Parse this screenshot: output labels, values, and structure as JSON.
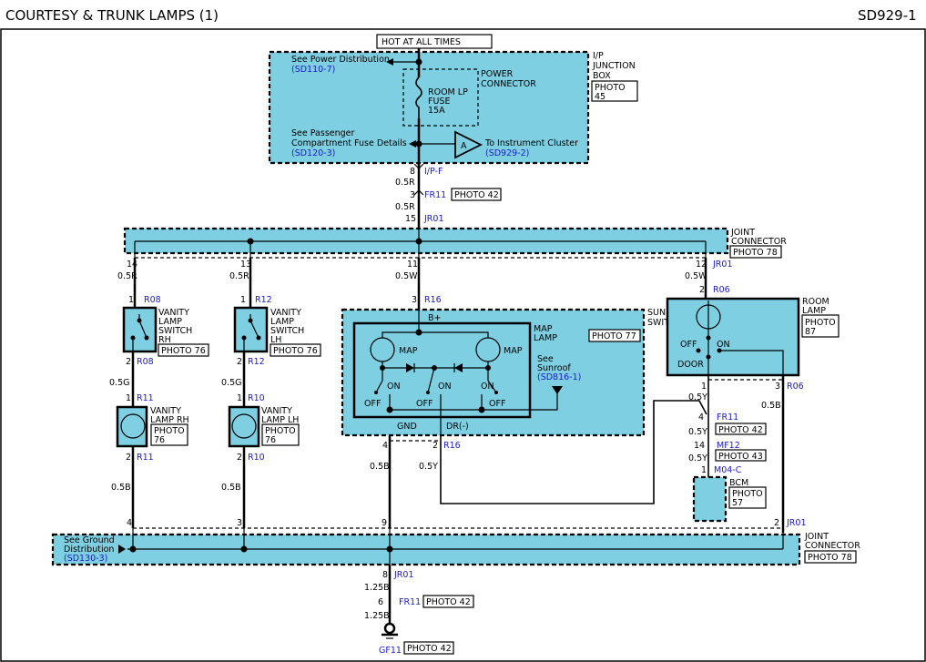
{
  "header": {
    "title": "COURTESY & TRUNK LAMPS (1)",
    "code": "SD929-1"
  },
  "colors": {
    "component_fill": "#7ecfe2",
    "reference_text": "#1a1acc"
  },
  "ipjb": {
    "hot": "HOT AT ALL TIMES",
    "see_power": "See Power Distribution",
    "sd110": "(SD110-7)",
    "power_connector": [
      "POWER",
      "CONNECTOR"
    ],
    "fuse": [
      "ROOM LP",
      "FUSE",
      "15A"
    ],
    "see_pass": [
      "See Passenger",
      "Compartment Fuse Details"
    ],
    "sd120": "(SD120-3)",
    "a": "A",
    "to_ic": "To Instrument Cluster",
    "sd929": "(SD929-2)",
    "name": [
      "I/P",
      "JUNCTION",
      "BOX"
    ],
    "photo": [
      "PHOTO",
      "45"
    ]
  },
  "feed": {
    "p8": "8",
    "ipf": "I/P-F",
    "w1": "0.5R",
    "p3": "3",
    "fr11": "FR11",
    "photo42": "PHOTO 42",
    "w2": "0.5R",
    "p15": "15",
    "jr01": "JR01"
  },
  "jc_top": {
    "name": [
      "JOINT",
      "CONNECTOR"
    ],
    "photo": "PHOTO 78",
    "pins": [
      "14",
      "13",
      "11",
      "12"
    ],
    "jr01": "JR01",
    "wires": [
      "0.5R",
      "0.5R",
      "0.5W",
      "0.5W"
    ]
  },
  "vanity_rh": {
    "p1": "1",
    "r08a": "R08",
    "name": [
      "VANITY",
      "LAMP",
      "SWITCH",
      "RH"
    ],
    "photo": "PHOTO 76",
    "p2": "2",
    "r08b": "R08",
    "w": "0.5G",
    "p1b": "1",
    "r11a": "R11",
    "lamp": [
      "VANITY",
      "LAMP RH"
    ],
    "lphoto": [
      "PHOTO",
      "76"
    ],
    "p2b": "2",
    "r11b": "R11",
    "w2": "0.5B"
  },
  "vanity_lh": {
    "p1": "1",
    "r12a": "R12",
    "name": [
      "VANITY",
      "LAMP",
      "SWITCH",
      "LH"
    ],
    "photo": "PHOTO 76",
    "p2": "2",
    "r12b": "R12",
    "w": "0.5G",
    "p1b": "1",
    "r10a": "R10",
    "lamp": [
      "VANITY",
      "LAMP LH"
    ],
    "lphoto": [
      "PHOTO",
      "76"
    ],
    "p2b": "2",
    "r10b": "R10",
    "w2": "0.5B"
  },
  "sunroof": {
    "p3": "3",
    "r16": "R16",
    "bplus": "B+",
    "name": [
      "SUNROOF",
      "SWITCH"
    ],
    "photo": "PHOTO 77",
    "map_lamp": [
      "MAP",
      "LAMP"
    ],
    "map": "MAP",
    "on": "ON",
    "off": "OFF",
    "see": [
      "See",
      "Sunroof"
    ],
    "sd816": "(SD816-1)",
    "gnd": "GND",
    "dr": "DR(-)",
    "p4": "4",
    "p2": "2",
    "r16b": "R16",
    "w_gnd": "0.5B",
    "w_dr": "0.5Y"
  },
  "room": {
    "p2": "2",
    "r06": "R06",
    "name": [
      "ROOM",
      "LAMP"
    ],
    "photo": [
      "PHOTO",
      "87"
    ],
    "off": "OFF",
    "on": "ON",
    "door": "DOOR",
    "p1": "1",
    "p3": "3",
    "r06b": "R06",
    "w1": "0.5Y",
    "w3": "0.5B",
    "p4": "4",
    "fr11": "FR11",
    "photo42": "PHOTO 42",
    "w4": "0.5Y",
    "p14": "14",
    "mf12": "MF12",
    "photo43": "PHOTO 43",
    "w5": "0.5Y",
    "pm1": "1",
    "m04": "M04-C",
    "bcm": "BCM",
    "bphoto": [
      "PHOTO",
      "57"
    ]
  },
  "jc_bot": {
    "pins": [
      "4",
      "3",
      "9",
      "2"
    ],
    "jr01": "JR01",
    "see": [
      "See Ground",
      "Distribution"
    ],
    "sd130": "(SD130-3)",
    "name": [
      "JOINT",
      "CONNECTOR"
    ],
    "photo": "PHOTO 78"
  },
  "ground": {
    "p8": "8",
    "jr01": "JR01",
    "w1": "1.25B",
    "p6": "6",
    "fr11": "FR11",
    "photo42": "PHOTO 42",
    "w2": "1.25B",
    "gf11": "GF11",
    "gphoto": "PHOTO 42"
  }
}
